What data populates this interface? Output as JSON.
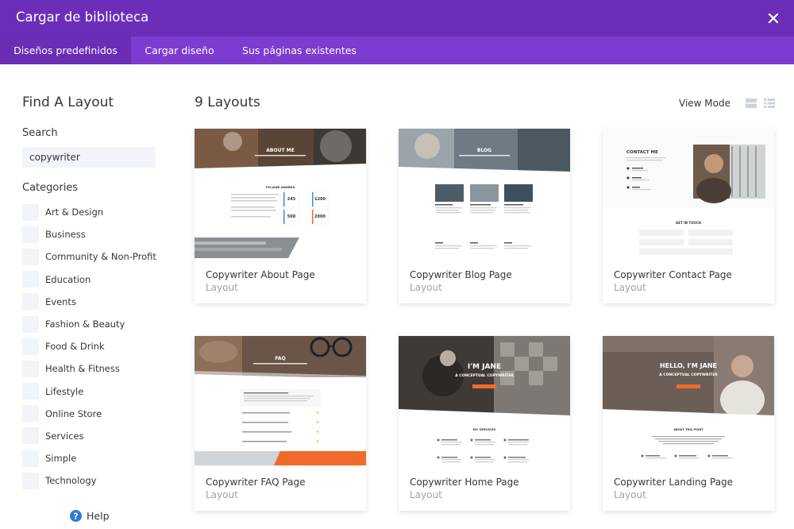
{
  "header": {
    "title": "Cargar de biblioteca",
    "close_icon": "close-icon"
  },
  "tabs": [
    {
      "label": "Diseños predefinidos",
      "active": true
    },
    {
      "label": "Cargar diseño",
      "active": false
    },
    {
      "label": "Sus páginas existentes",
      "active": false
    }
  ],
  "sidebar": {
    "title": "Find A Layout",
    "search_label": "Search",
    "search_value": "copywriter",
    "categories_label": "Categories",
    "categories": [
      "Art & Design",
      "Business",
      "Community & Non-Profit",
      "Education",
      "Events",
      "Fashion & Beauty",
      "Food & Drink",
      "Health & Fitness",
      "Lifestyle",
      "Online Store",
      "Services",
      "Simple",
      "Technology"
    ],
    "help_label": "Help"
  },
  "main": {
    "count_label": "9 Layouts",
    "view_mode_label": "View Mode",
    "layouts": [
      {
        "name": "Copywriter About Page",
        "type": "Layout",
        "thumb": {
          "banner": "ABOUT ME",
          "heading": "I'M JANE ANDREA",
          "stats": [
            "245",
            "1200",
            "500",
            "2000"
          ]
        }
      },
      {
        "name": "Copywriter Blog Page",
        "type": "Layout",
        "thumb": {
          "banner": "BLOG"
        }
      },
      {
        "name": "Copywriter Contact Page",
        "type": "Layout",
        "thumb": {
          "heading": "CONTACT ME",
          "form_title": "GET IN TOUCH"
        }
      },
      {
        "name": "Copywriter FAQ Page",
        "type": "Layout",
        "thumb": {
          "banner": "FAQ"
        }
      },
      {
        "name": "Copywriter Home Page",
        "type": "Layout",
        "thumb": {
          "banner": "I'M JANE",
          "sub": "A CONCEPTUAL COPYWRITER",
          "section": "MY SERVICES"
        }
      },
      {
        "name": "Copywriter Landing Page",
        "type": "Layout",
        "thumb": {
          "banner": "HELLO, I'M JANE",
          "sub": "A CONCEPTUAL COPYWRITER",
          "section": "ABOUT THIS POINT"
        }
      }
    ]
  },
  "colors": {
    "header": "#6c2eb9",
    "tabs": "#7e3bd0",
    "tab_active": "#6a2db6",
    "accent_orange": "#f26a2a",
    "help_blue": "#2e7ad6"
  }
}
